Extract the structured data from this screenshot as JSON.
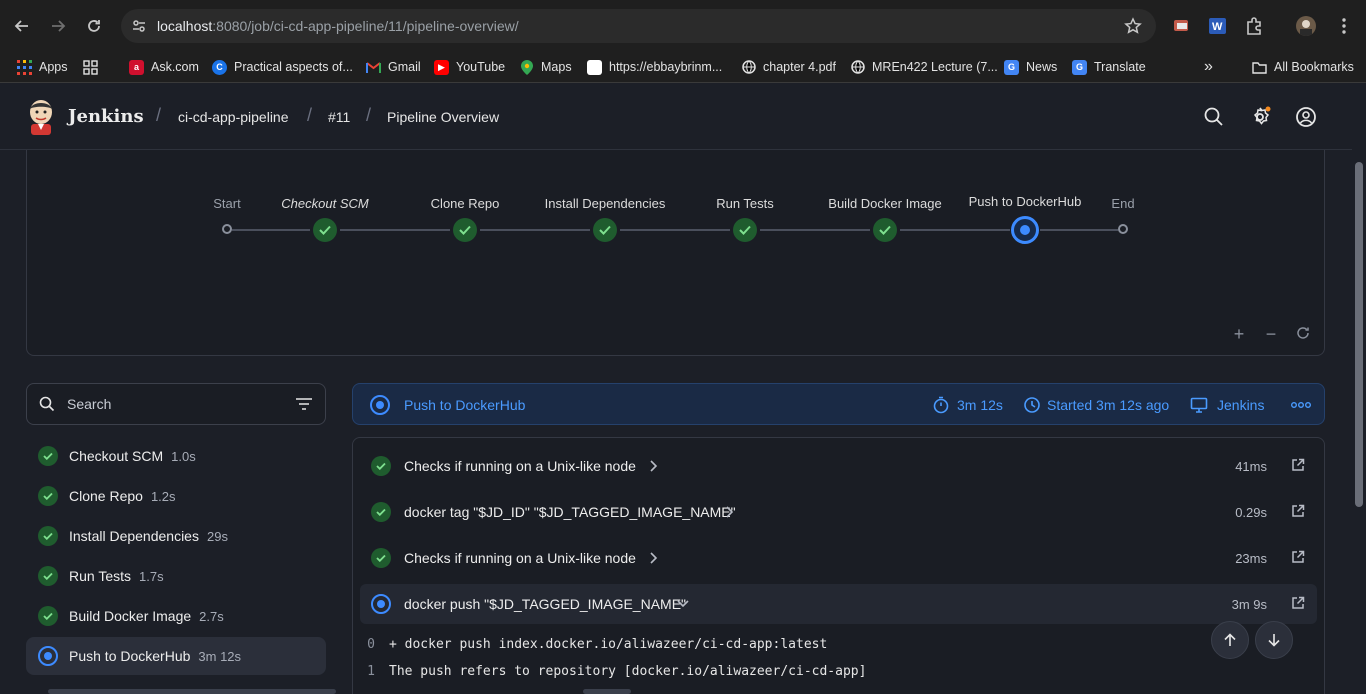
{
  "browser": {
    "url_host": "localhost",
    "url_rest": ":8080/job/ci-cd-app-pipeline/11/pipeline-overview/",
    "bookmarks": [
      {
        "label": "Apps",
        "icon": "apps-grid-icon"
      },
      {
        "label": "",
        "icon": "grid-icon"
      },
      {
        "label": "Ask.com",
        "icon": "ask-icon"
      },
      {
        "label": "Practical aspects of...",
        "icon": "c-icon"
      },
      {
        "label": "Gmail",
        "icon": "gmail-icon"
      },
      {
        "label": "YouTube",
        "icon": "youtube-icon"
      },
      {
        "label": "Maps",
        "icon": "maps-icon"
      },
      {
        "label": "https://ebbaybrinm...",
        "icon": "page-icon"
      },
      {
        "label": "chapter 4.pdf",
        "icon": "globe-icon"
      },
      {
        "label": "MREn422 Lecture (7...",
        "icon": "globe-icon"
      },
      {
        "label": "News",
        "icon": "news-icon"
      },
      {
        "label": "Translate",
        "icon": "translate-icon"
      }
    ],
    "all_bookmarks": "All Bookmarks"
  },
  "header": {
    "title": "Jenkins",
    "breadcrumbs": [
      "ci-cd-app-pipeline",
      "#11",
      "Pipeline Overview"
    ]
  },
  "graph": {
    "start_label": "Start",
    "end_label": "End",
    "stages": [
      {
        "label": "Checkout SCM",
        "status": "success"
      },
      {
        "label": "Clone Repo",
        "status": "success"
      },
      {
        "label": "Install Dependencies",
        "status": "success"
      },
      {
        "label": "Run Tests",
        "status": "success"
      },
      {
        "label": "Build Docker Image",
        "status": "success"
      },
      {
        "label": "Push to DockerHub",
        "status": "running"
      }
    ]
  },
  "sidebar": {
    "search_placeholder": "Search",
    "stages": [
      {
        "name": "Checkout SCM",
        "duration": "1.0s",
        "status": "success"
      },
      {
        "name": "Clone Repo",
        "duration": "1.2s",
        "status": "success"
      },
      {
        "name": "Install Dependencies",
        "duration": "29s",
        "status": "success"
      },
      {
        "name": "Run Tests",
        "duration": "1.7s",
        "status": "success"
      },
      {
        "name": "Build Docker Image",
        "duration": "2.7s",
        "status": "success"
      },
      {
        "name": "Push to DockerHub",
        "duration": "3m 12s",
        "status": "running"
      }
    ]
  },
  "stage_detail": {
    "title": "Push to DockerHub",
    "duration": "3m 12s",
    "started": "Started 3m 12s ago",
    "agent": "Jenkins",
    "more": "ooo"
  },
  "steps": [
    {
      "text": "Checks if running on a Unix-like node",
      "duration": "41ms",
      "status": "success",
      "expanded": false
    },
    {
      "text": "docker tag \"$JD_ID\" \"$JD_TAGGED_IMAGE_NAME\"",
      "duration": "0.29s",
      "status": "success",
      "expanded": false
    },
    {
      "text": "Checks if running on a Unix-like node",
      "duration": "23ms",
      "status": "success",
      "expanded": false
    },
    {
      "text": "docker push \"$JD_TAGGED_IMAGE_NAME\"",
      "duration": "3m 9s",
      "status": "running",
      "expanded": true
    }
  ],
  "log": [
    {
      "n": "0",
      "text": "+ docker push index.docker.io/aliwazeer/ci-cd-app:latest"
    },
    {
      "n": "1",
      "text": "The push refers to repository [docker.io/aliwazeer/ci-cd-app]"
    }
  ],
  "colors": {
    "accent": "#3d8bff",
    "success": "#2ea043",
    "background": "#1c1f27"
  }
}
